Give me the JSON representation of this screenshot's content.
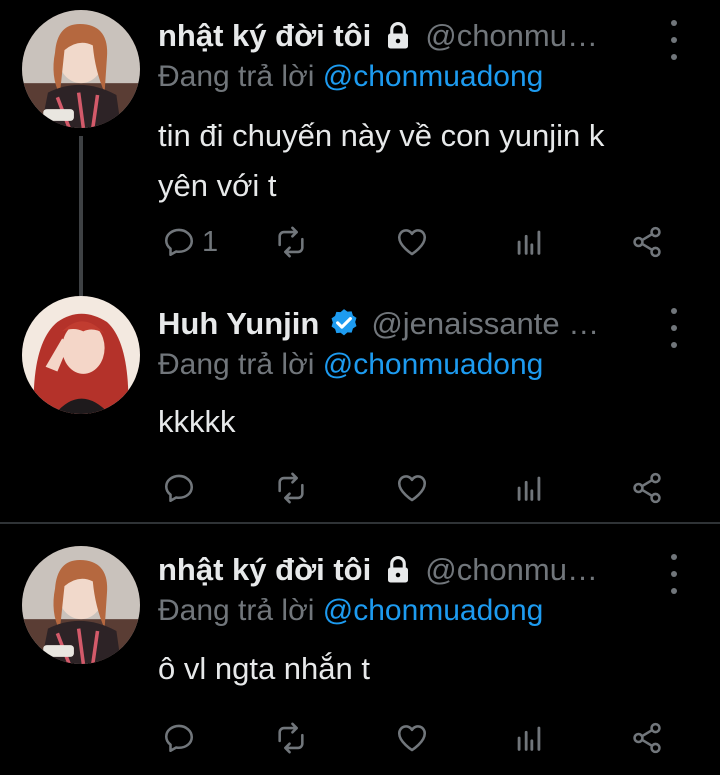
{
  "colors": {
    "background": "#000000",
    "text": "#e7e9ea",
    "secondary": "#71767b",
    "accent": "#1d9bf0",
    "divider": "#2f3336"
  },
  "tweets": [
    {
      "display_name": "nhật ký đời tôi",
      "handle": "@chonmu…",
      "badge": "lock-icon",
      "reply_prefix": "Đang trả lời",
      "reply_to": "@chonmuadong",
      "text_lines": [
        "tin đi chuyến này về con yunjin k",
        "yên với t"
      ],
      "reply_count": "1"
    },
    {
      "display_name": "Huh Yunjin",
      "handle": "@jenaissante …",
      "badge": "verified-icon",
      "reply_prefix": "Đang trả lời",
      "reply_to": "@chonmuadong",
      "text_lines": [
        "kkkkk"
      ],
      "reply_count": ""
    },
    {
      "display_name": "nhật ký đời tôi",
      "handle": "@chonmu…",
      "badge": "lock-icon",
      "reply_prefix": "Đang trả lời",
      "reply_to": "@chonmuadong",
      "text_lines": [
        "ô vl ngta nhắn t"
      ],
      "reply_count": ""
    }
  ]
}
